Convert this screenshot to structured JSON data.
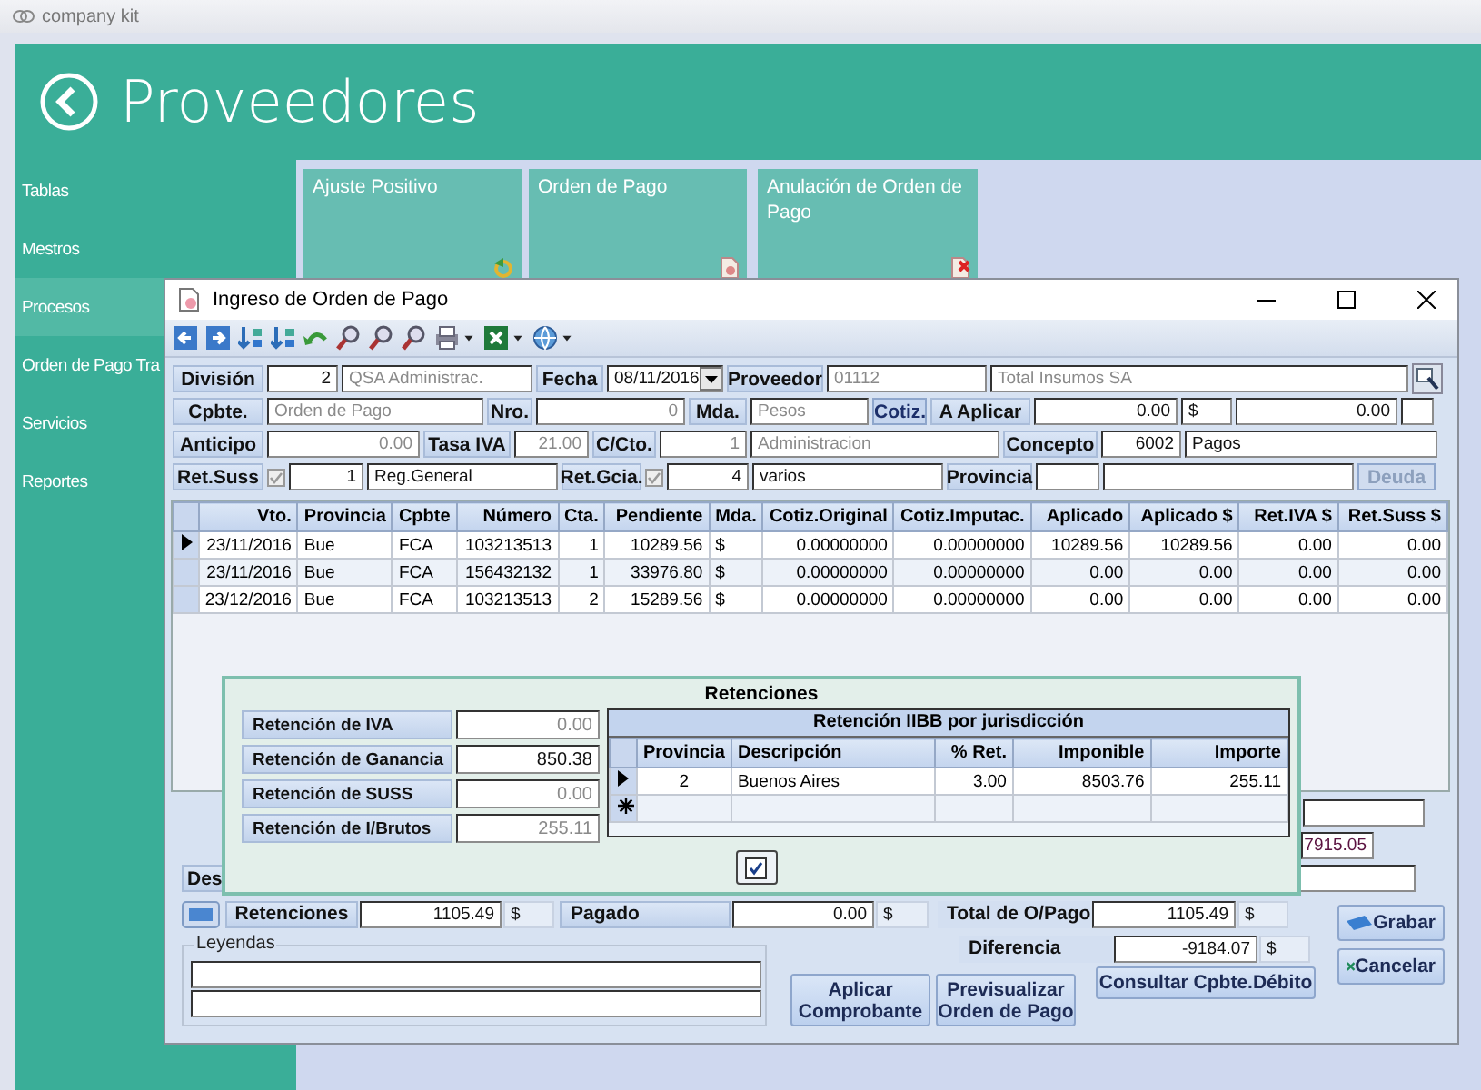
{
  "app": {
    "title": "company kit",
    "heading": "Proveedores"
  },
  "sidebar": {
    "items": [
      {
        "label": "Tablas",
        "selected": false
      },
      {
        "label": "Mestros",
        "selected": false
      },
      {
        "label": "Procesos",
        "selected": true
      },
      {
        "label": "Orden de Pago Tra",
        "selected": false
      },
      {
        "label": "Servicios",
        "selected": false
      },
      {
        "label": "Reportes",
        "selected": false
      }
    ]
  },
  "tiles": [
    {
      "label": "Ajuste Positivo"
    },
    {
      "label": "Orden de Pago"
    },
    {
      "label": "Anulación de Orden de Pago"
    }
  ],
  "dialog": {
    "title": "Ingreso de Orden de Pago",
    "form": [
      [
        {
          "kind": "label",
          "text": "División"
        },
        {
          "kind": "number",
          "text": "2"
        },
        {
          "kind": "text",
          "text": "QSA Administrac.",
          "disabled": true
        },
        {
          "kind": "label",
          "text": "Fecha"
        },
        {
          "kind": "combo",
          "text": "08/11/2016"
        },
        {
          "kind": "label",
          "text": "Proveedor"
        },
        {
          "kind": "text",
          "text": "01112",
          "disabled": true
        },
        {
          "kind": "text",
          "text": "Total Insumos SA",
          "disabled": true
        },
        {
          "kind": "icon-button"
        }
      ],
      [
        {
          "kind": "label",
          "text": "Cpbte."
        },
        {
          "kind": "text",
          "text": "Orden de Pago",
          "disabled": true
        },
        {
          "kind": "label",
          "text": "Nro."
        },
        {
          "kind": "number",
          "text": "0",
          "disabled": true
        },
        {
          "kind": "label",
          "text": "Mda."
        },
        {
          "kind": "text",
          "text": "Pesos",
          "disabled": true
        },
        {
          "kind": "button",
          "text": "Cotiz."
        },
        {
          "kind": "label",
          "text": "A Aplicar"
        },
        {
          "kind": "number",
          "text": "0.00"
        },
        {
          "kind": "text",
          "text": "$"
        },
        {
          "kind": "number",
          "text": "0.00"
        },
        {
          "kind": "text"
        }
      ],
      [
        {
          "kind": "label",
          "text": "Anticipo"
        },
        {
          "kind": "number",
          "text": "0.00",
          "disabled": true
        },
        {
          "kind": "label",
          "text": "Tasa IVA"
        },
        {
          "kind": "number",
          "text": "21.00",
          "disabled": true
        },
        {
          "kind": "label",
          "text": "C/Cto."
        },
        {
          "kind": "number",
          "text": "1",
          "disabled": true
        },
        {
          "kind": "text",
          "text": "Administracion",
          "disabled": true
        },
        {
          "kind": "label",
          "text": "Concepto"
        },
        {
          "kind": "number",
          "text": "6002"
        },
        {
          "kind": "text",
          "text": "Pagos"
        }
      ],
      [
        {
          "kind": "label",
          "text": "Ret.Suss"
        },
        {
          "kind": "check",
          "checked": true
        },
        {
          "kind": "number",
          "text": "1"
        },
        {
          "kind": "text",
          "text": "Reg.General"
        },
        {
          "kind": "label",
          "text": "Ret.Gcia."
        },
        {
          "kind": "check",
          "checked": true
        },
        {
          "kind": "number",
          "text": "4"
        },
        {
          "kind": "text",
          "text": "varios"
        },
        {
          "kind": "label",
          "text": "Provincia"
        },
        {
          "kind": "text"
        },
        {
          "kind": "text"
        },
        {
          "kind": "button",
          "text": "Deuda",
          "disabled": true
        }
      ]
    ],
    "table": {
      "columns": [
        "Vto.",
        "Provincia",
        "Cpbte",
        "Número",
        "Cta.",
        "Pendiente",
        "Mda.",
        "Cotiz.Original",
        "Cotiz.Imputac.",
        "Aplicado",
        "Aplicado $",
        "Ret.IVA $",
        "Ret.Suss $"
      ],
      "rows": [
        {
          "selected": true,
          "cells": [
            "23/11/2016",
            "Bue",
            "FCA",
            "103213513",
            "1",
            "10289.56",
            "$",
            "0.00000000",
            "0.00000000",
            "10289.56",
            "10289.56",
            "0.00",
            "0.00"
          ]
        },
        {
          "selected": false,
          "cells": [
            "23/11/2016",
            "Bue",
            "FCA",
            "156432132",
            "1",
            "33976.80",
            "$",
            "0.00000000",
            "0.00000000",
            "0.00",
            "0.00",
            "0.00",
            "0.00"
          ]
        },
        {
          "selected": false,
          "cells": [
            "23/12/2016",
            "Bue",
            "FCA",
            "103213513",
            "2",
            "15289.56",
            "$",
            "0.00000000",
            "0.00000000",
            "0.00",
            "0.00",
            "0.00",
            "0.00"
          ]
        }
      ]
    },
    "hidden_label": "Des",
    "hidden_total": "7915.05",
    "retenciones": {
      "label": "Retenciones",
      "value": "1105.49",
      "currency": "$"
    },
    "pagado": {
      "label": "Pagado",
      "value": "0.00",
      "currency": "$"
    },
    "total": {
      "label": "Total de O/Pago",
      "value": "1105.49",
      "currency": "$"
    },
    "diferencia": {
      "label": "Diferencia",
      "value": "-9184.07",
      "currency": "$"
    },
    "leyendas": {
      "legend": "Leyendas"
    },
    "actions": [
      "Aplicar Comprobante",
      "Previsualizar Orden de Pago"
    ],
    "consultar": "Consultar Cpbte.Débito",
    "grabar": "Grabar",
    "cancelar": "Cancelar"
  },
  "popup": {
    "title": "Retenciones",
    "fields": [
      {
        "label": "Retención de IVA",
        "value": "0.00",
        "disabled": true
      },
      {
        "label": "Retención de Ganancia",
        "value": "850.38",
        "disabled": false
      },
      {
        "label": "Retención de SUSS",
        "value": "0.00",
        "disabled": true
      },
      {
        "label": "Retención de I/Brutos",
        "value": "255.11",
        "disabled": true
      }
    ],
    "iibb": {
      "title": "Retención IIBB por jurisdicción",
      "columns": [
        "Provincia",
        "Descripción",
        "% Ret.",
        "Imponible",
        "Importe"
      ],
      "rows": [
        {
          "selected": true,
          "cells": [
            "2",
            "Buenos Aires",
            "3.00",
            "8503.76",
            "255.11"
          ]
        }
      ]
    }
  }
}
